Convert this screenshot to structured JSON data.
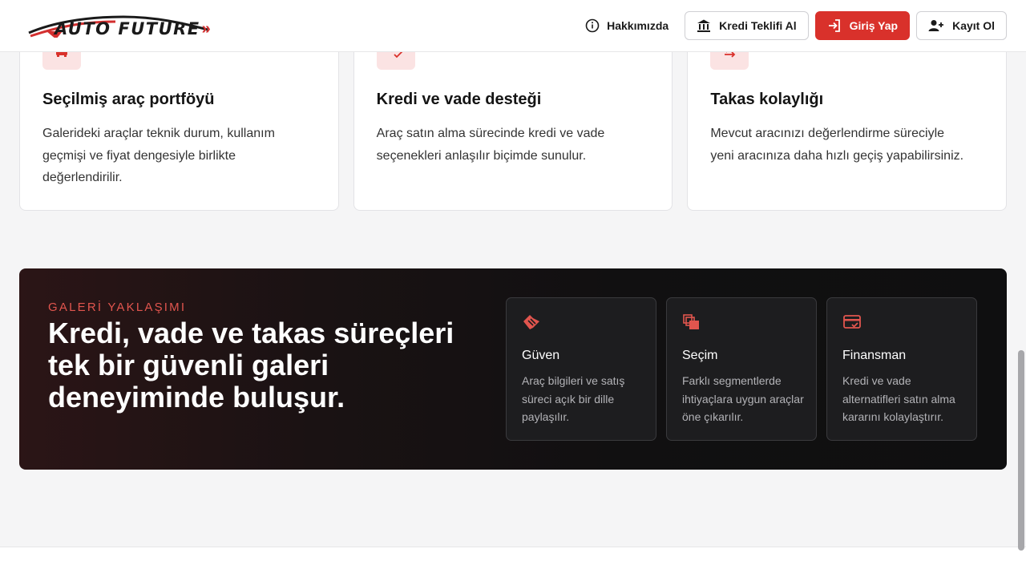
{
  "header": {
    "logo_text": "AUTO FUTURE",
    "logo_chevrons": "»",
    "nav": {
      "about": "Hakkımızda",
      "credit": "Kredi Teklifi Al",
      "login": "Giriş Yap",
      "register": "Kayıt Ol"
    }
  },
  "cards": [
    {
      "icon": "car-icon",
      "title": "Seçilmiş araç portföyü",
      "text": "Galerideki araçlar teknik durum, kullanım geçmişi ve fiyat dengesiyle birlikte değerlendirilir."
    },
    {
      "icon": "checklist-icon",
      "title": "Kredi ve vade desteği",
      "text": "Araç satın alma sürecinde kredi ve vade seçenekleri anlaşılır biçimde sunulur."
    },
    {
      "icon": "swap-icon",
      "title": "Takas kolaylığı",
      "text": "Mevcut aracınızı değerlendirme süreciyle yeni aracınıza daha hızlı geçiş yapabilirsiniz."
    }
  ],
  "banner": {
    "eyebrow": "GALERİ YAKLAŞIMI",
    "headline": "Kredi, vade ve takas süreçleri tek bir güvenli galeri deneyiminde buluşur.",
    "features": [
      {
        "icon": "handshake-icon",
        "title": "Güven",
        "text": "Araç bilgileri ve satış süreci açık bir dille paylaşılır."
      },
      {
        "icon": "layers-icon",
        "title": "Seçim",
        "text": "Farklı segmentlerde ihtiyaçlara uygun araçlar öne çıkarılır."
      },
      {
        "icon": "credit-card-icon",
        "title": "Finansman",
        "text": "Kredi ve vade alternatifleri satın alma kararını kolaylaştırır."
      }
    ]
  },
  "colors": {
    "accent": "#d9312b",
    "accent_soft": "#fbe3e3",
    "banner_dark": "#111011",
    "eyebrow": "#e1554e"
  }
}
